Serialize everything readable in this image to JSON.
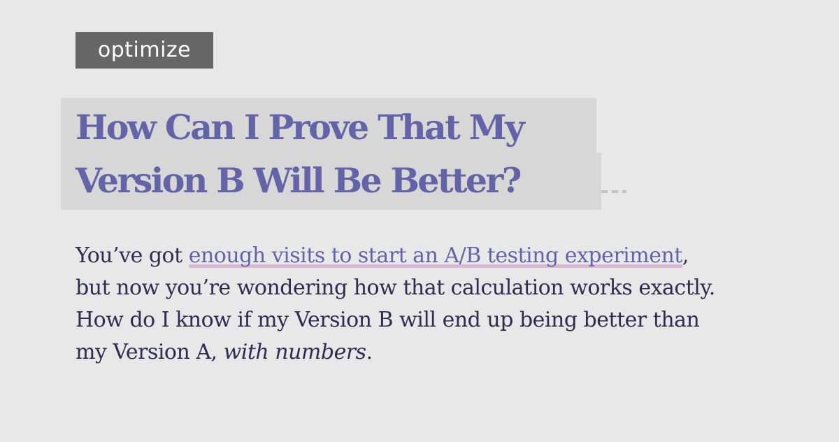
{
  "tag": {
    "label": "optimize"
  },
  "title": {
    "line1": "How Can I Prove That My",
    "line2": "Version B Will Be Better?"
  },
  "intro": {
    "text_before_link": "You’ve got ",
    "link_text": "enough visits to start an A/B testing experiment",
    "text_after_link": ", but now you’re wondering how that calculation works exactly. How do I know if my Version B will end up being better than my Version A, ",
    "emphasis": "with numbers",
    "ending": "."
  },
  "colors": {
    "background": "#e8e8e9",
    "tag_background": "#666666",
    "title": "#6264a7",
    "title_highlight": "#d7d7d8",
    "body_text": "#2f2c4f",
    "link_underline": "#dbb9d6"
  }
}
